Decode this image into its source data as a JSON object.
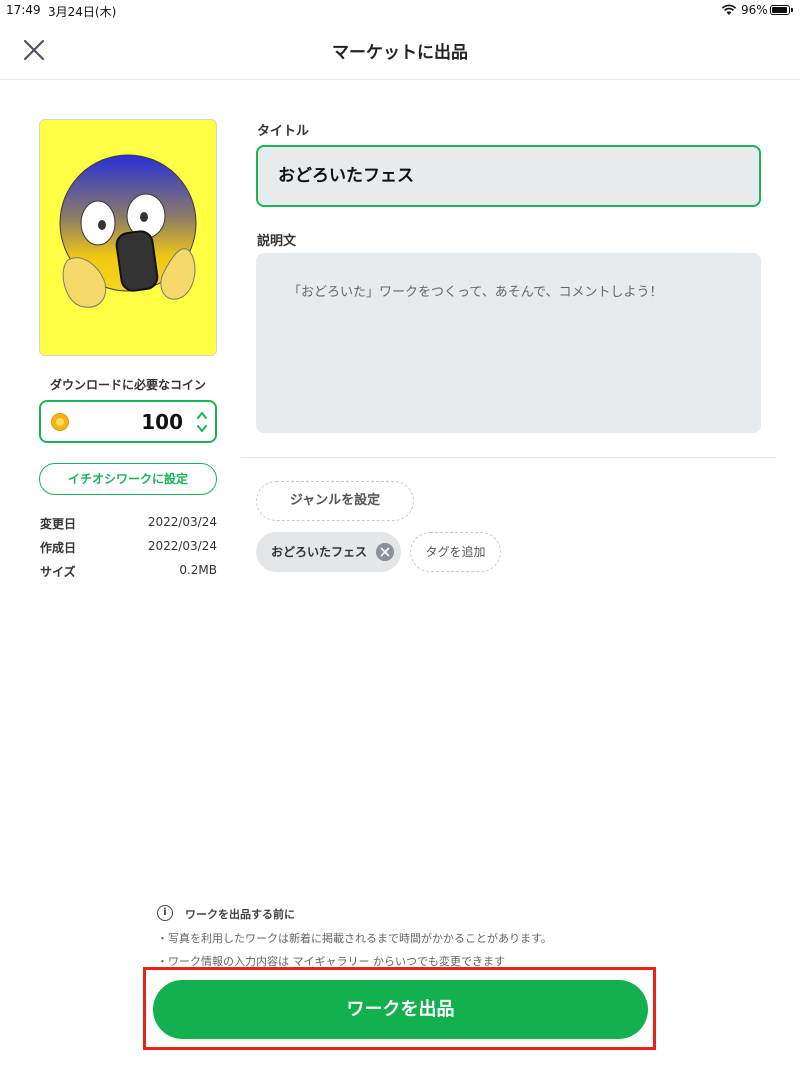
{
  "status_bar": {
    "time": "17:49",
    "date": "3月24日(木)",
    "battery": "96%"
  },
  "header": {
    "title": "マーケットに出品"
  },
  "left": {
    "coin_label": "ダウンロードに必要なコイン",
    "coin_value": "100",
    "pick_button": "イチオシワークに設定",
    "meta": [
      {
        "label": "変更日",
        "value": "2022/03/24"
      },
      {
        "label": "作成日",
        "value": "2022/03/24"
      },
      {
        "label": "サイズ",
        "value": "0.2MB"
      }
    ]
  },
  "form": {
    "title_label": "タイトル",
    "title_value": "おどろいたフェス",
    "desc_label": "説明文",
    "desc_value": "「おどろいた」ワークをつくって、あそんで、コメントしよう！",
    "genre_button": "ジャンルを設定",
    "tags": [
      "おどろいたフェス"
    ],
    "add_tag": "タグを追加"
  },
  "notes": {
    "title": "ワークを出品する前に",
    "lines": [
      "・写真を利用したワークは新着に掲載されるまで時間がかかることがあります。",
      "・ワーク情報の入力内容は マイギャラリー からいつでも変更できます"
    ]
  },
  "submit_button": "ワークを出品",
  "colors": {
    "accent": "#12b04f",
    "highlight_outline": "#e8251b",
    "thumbnail_bg": "#ffff44"
  }
}
